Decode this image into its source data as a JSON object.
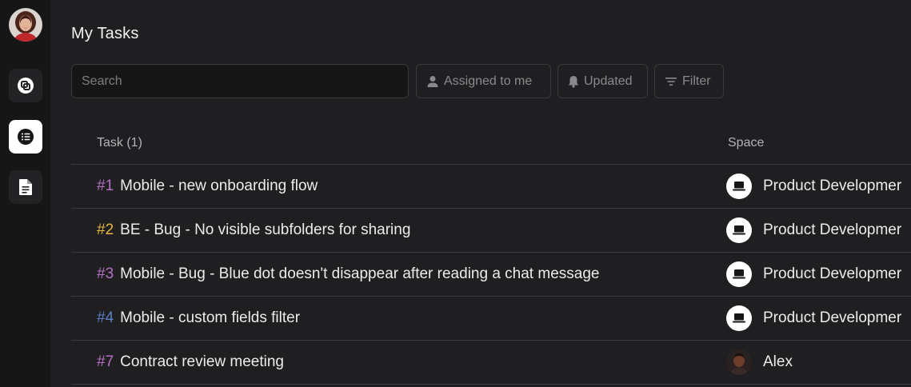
{
  "sidebar": {
    "avatar_icon": "user-avatar",
    "items": [
      {
        "icon": "space-switch-icon",
        "active": false
      },
      {
        "icon": "task-list-icon",
        "active": true
      },
      {
        "icon": "document-icon",
        "active": false
      }
    ]
  },
  "main": {
    "title": "My Tasks",
    "search": {
      "placeholder": "Search",
      "value": ""
    },
    "filters": {
      "assigned_label": "Assigned to me",
      "updated_label": "Updated",
      "filter_label": "Filter"
    }
  },
  "table": {
    "columns": {
      "task": "Task (1)",
      "space": "Space"
    },
    "rows": [
      {
        "id": "#1",
        "id_color": "#b56fc4",
        "title": "Mobile - new onboarding flow",
        "space": "Product Developmer",
        "space_icon": "laptop-icon"
      },
      {
        "id": "#2",
        "id_color": "#e8b53f",
        "title": "BE - Bug - No visible subfolders for sharing",
        "space": "Product Developmer",
        "space_icon": "laptop-icon"
      },
      {
        "id": "#3",
        "id_color": "#b56fc4",
        "title": "Mobile - Bug - Blue dot doesn't disappear after reading a chat message",
        "space": "Product Developmer",
        "space_icon": "laptop-icon"
      },
      {
        "id": "#4",
        "id_color": "#5b7fbf",
        "title": "Mobile - custom fields filter",
        "space": "Product Developmer",
        "space_icon": "laptop-icon"
      },
      {
        "id": "#7",
        "id_color": "#b56fc4",
        "title": "Contract review meeting",
        "space": "Alex",
        "space_icon": "user-avatar"
      }
    ]
  },
  "colors": {
    "background": "#1f1f21",
    "sidebar": "#161617",
    "border": "#3b3b3d",
    "text": "#ececec",
    "muted": "#8a8a8d"
  }
}
